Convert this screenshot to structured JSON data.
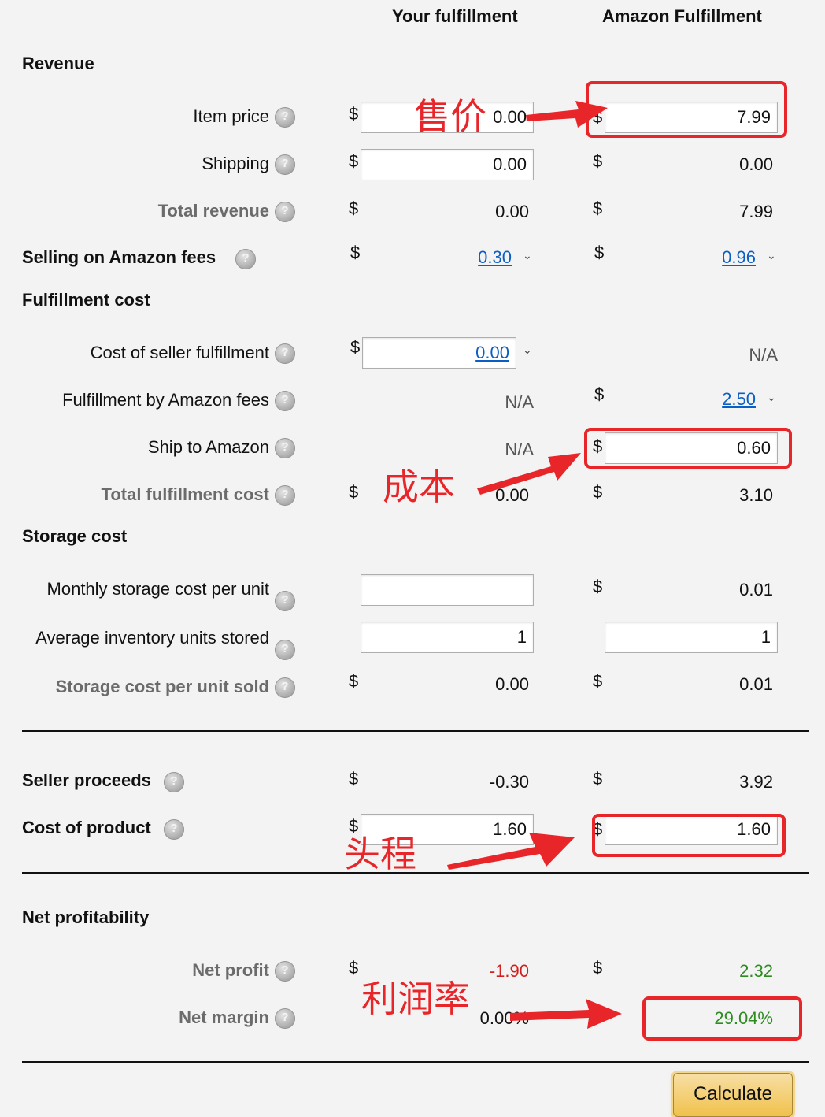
{
  "header": {
    "your_col": "Your fulfillment",
    "amazon_col": "Amazon Fulfillment"
  },
  "currency": "$",
  "revenue": {
    "title": "Revenue",
    "item_price": {
      "label": "Item price",
      "yours": "0.00",
      "amazon": "7.99"
    },
    "shipping": {
      "label": "Shipping",
      "yours": "0.00",
      "amazon": "0.00"
    },
    "total": {
      "label": "Total revenue",
      "yours": "0.00",
      "amazon": "7.99"
    }
  },
  "selling_fees": {
    "label": "Selling on Amazon fees",
    "yours": "0.30",
    "amazon": "0.96"
  },
  "fulfillment": {
    "title": "Fulfillment cost",
    "seller_fulfillment": {
      "label": "Cost of seller fulfillment",
      "yours": "0.00",
      "amazon": "N/A"
    },
    "fba_fees": {
      "label": "Fulfillment by Amazon fees",
      "yours": "N/A",
      "amazon": "2.50"
    },
    "ship_to_amazon": {
      "label": "Ship to Amazon",
      "yours": "N/A",
      "amazon": "0.60"
    },
    "total": {
      "label": "Total fulfillment cost",
      "yours": "0.00",
      "amazon": "3.10"
    }
  },
  "storage": {
    "title": "Storage cost",
    "monthly": {
      "label": "Monthly storage cost per unit",
      "yours": "",
      "amazon": "0.01"
    },
    "avg_units": {
      "label": "Average inventory units stored",
      "yours": "1",
      "amazon": "1"
    },
    "per_unit_sold": {
      "label": "Storage cost per unit sold",
      "yours": "0.00",
      "amazon": "0.01"
    }
  },
  "proceeds": {
    "label": "Seller proceeds",
    "yours": "-0.30",
    "amazon": "3.92"
  },
  "cost_of_product": {
    "label": "Cost of product",
    "yours": "1.60",
    "amazon": "1.60"
  },
  "net": {
    "title": "Net profitability",
    "profit": {
      "label": "Net profit",
      "yours": "-1.90",
      "amazon": "2.32"
    },
    "margin": {
      "label": "Net margin",
      "yours": "0.00%",
      "amazon": "29.04%"
    }
  },
  "calculate_label": "Calculate",
  "annotations": {
    "price": "售价",
    "cost": "成本",
    "freight": "头程",
    "margin": "利润率"
  },
  "colors": {
    "annotation": "#e8262a",
    "negative": "#d11f1f",
    "positive": "#2e8b22",
    "link": "#0a5ec4"
  }
}
